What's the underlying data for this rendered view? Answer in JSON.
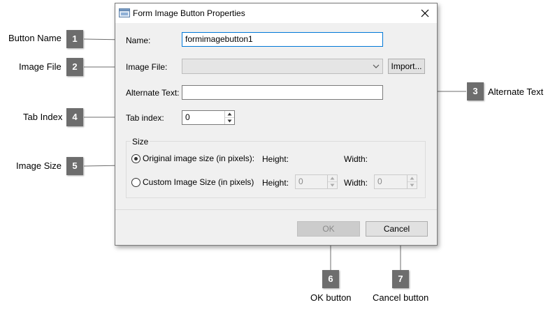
{
  "dialog": {
    "title": "Form Image Button Properties",
    "name_label": "Name:",
    "name_value": "formimagebutton1",
    "image_file_label": "Image File:",
    "import_label": "Import...",
    "alt_text_label": "Alternate Text:",
    "alt_text_value": "",
    "tab_index_label": "Tab index:",
    "tab_index_value": "0",
    "size_group_label": "Size",
    "original_size_label": "Original image size (in pixels):",
    "custom_size_label": "Custom Image Size (in pixels)",
    "height_label": "Height:",
    "width_label": "Width:",
    "custom_height_value": "0",
    "custom_width_value": "0",
    "selected_size_option": "original",
    "ok_label": "OK",
    "cancel_label": "Cancel"
  },
  "callouts": [
    {
      "number": "1",
      "label": "Button Name"
    },
    {
      "number": "2",
      "label": "Image File"
    },
    {
      "number": "3",
      "label": "Alternate Text"
    },
    {
      "number": "4",
      "label": "Tab Index"
    },
    {
      "number": "5",
      "label": "Image Size"
    },
    {
      "number": "6",
      "label": "OK button"
    },
    {
      "number": "7",
      "label": "Cancel button"
    }
  ],
  "colors": {
    "badge": "#6d6d6d",
    "dialog_bg": "#f0f0f0",
    "focus_border": "#0078d7"
  },
  "icons": {
    "app": "window-app-icon",
    "close": "close-icon",
    "dropdown": "chevron-down-icon"
  }
}
